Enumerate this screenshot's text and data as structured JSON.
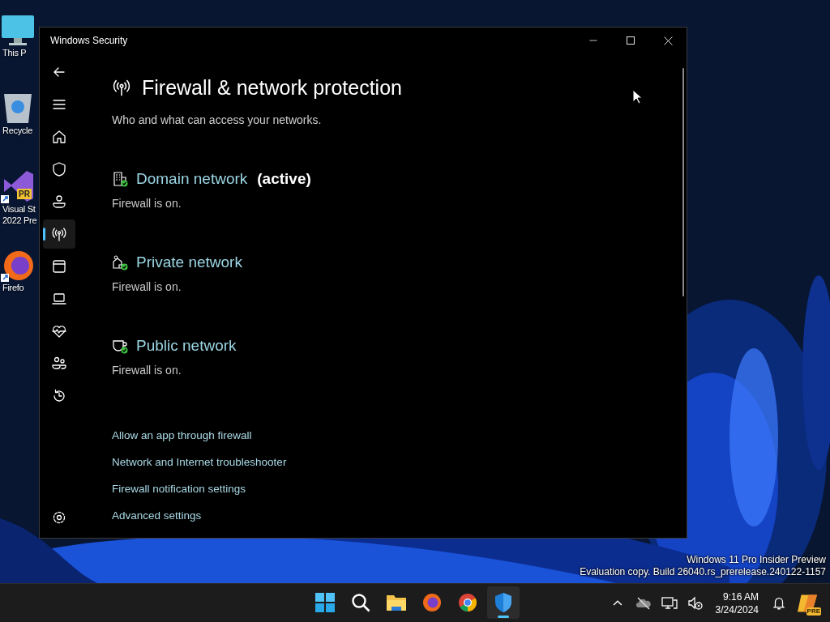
{
  "desktop": {
    "icons": [
      {
        "lines": [
          "This P"
        ]
      },
      {
        "lines": [
          "Recycle"
        ]
      },
      {
        "lines": [
          "Visual St",
          "2022 Pre"
        ],
        "badge": "PR"
      },
      {
        "lines": [
          "Firefo"
        ]
      }
    ]
  },
  "window": {
    "title": "Windows Security"
  },
  "sidebar": {
    "items": [
      {
        "selected": false
      },
      {
        "selected": false
      },
      {
        "selected": false
      },
      {
        "selected": false
      },
      {
        "selected": false
      },
      {
        "selected": true
      },
      {
        "selected": false
      },
      {
        "selected": false
      },
      {
        "selected": false
      },
      {
        "selected": false
      },
      {
        "selected": false
      },
      {
        "selected": false
      }
    ]
  },
  "page": {
    "title": "Firewall & network protection",
    "subtitle": "Who and what can access your networks.",
    "networks": [
      {
        "name": "Domain network",
        "suffix": "(active)",
        "status": "Firewall is on."
      },
      {
        "name": "Private network",
        "status": "Firewall is on."
      },
      {
        "name": "Public network",
        "status": "Firewall is on."
      }
    ],
    "links": [
      "Allow an app through firewall",
      "Network and Internet troubleshooter",
      "Firewall notification settings",
      "Advanced settings"
    ]
  },
  "build_info": [
    "Windows 11 Pro Insider Preview",
    "Evaluation copy. Build 26040.rs_prerelease.240122-1157"
  ],
  "taskbar": {
    "apps": [
      {
        "selected": false
      },
      {
        "selected": false
      },
      {
        "selected": false
      },
      {
        "selected": false
      },
      {
        "selected": false
      },
      {
        "selected": true
      }
    ],
    "time": "9:16 AM",
    "date": "3/24/2024",
    "copilot_badge": "PRE"
  }
}
